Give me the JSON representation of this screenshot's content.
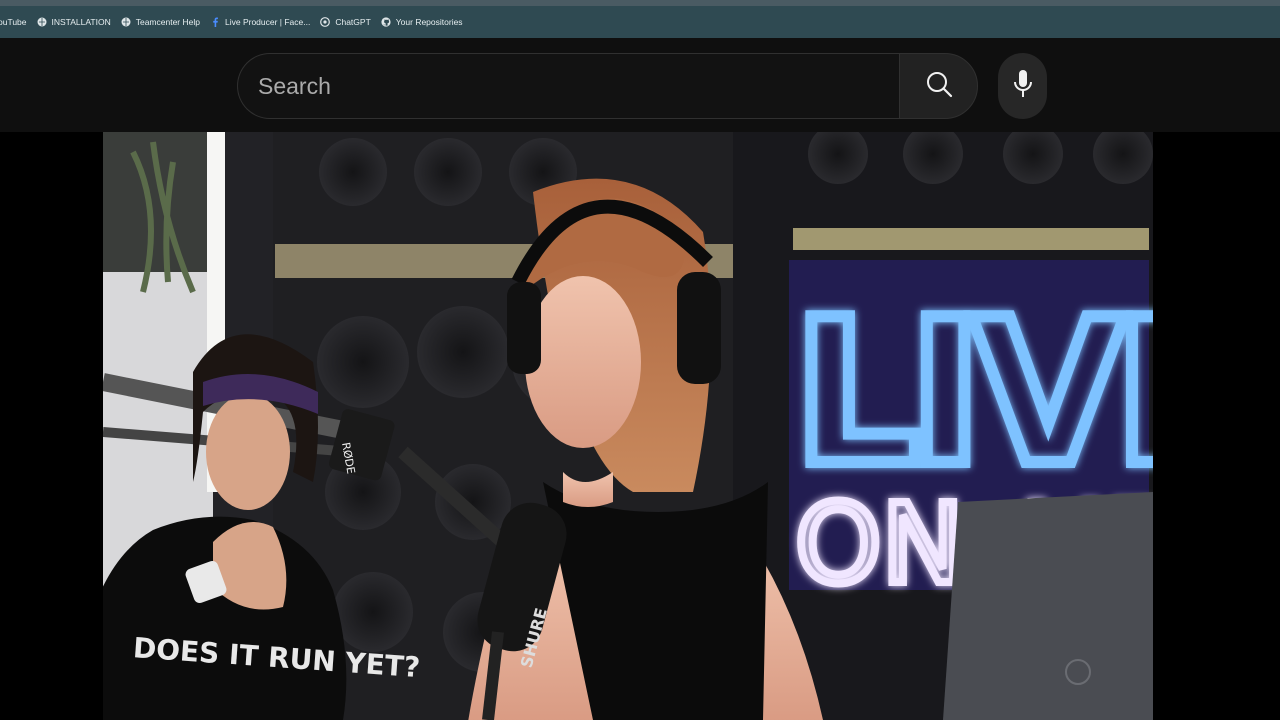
{
  "bookmarks": [
    {
      "label": "ouTube",
      "icon": "youtube-icon"
    },
    {
      "label": "INSTALLATION",
      "icon": "globe-icon"
    },
    {
      "label": "Teamcenter Help",
      "icon": "globe-icon"
    },
    {
      "label": "Live Producer | Face...",
      "icon": "facebook-icon"
    },
    {
      "label": "ChatGPT",
      "icon": "chatgpt-icon"
    },
    {
      "label": "Your Repositories",
      "icon": "github-icon"
    }
  ],
  "search": {
    "placeholder": "Search",
    "value": ""
  },
  "video": {
    "neon_sign_line1": "LIVE",
    "neon_sign_line2": "ON AIR",
    "shirt_text": "DOES IT RUN YET?",
    "mic_brand": "SHURE",
    "boom_brand": "RØDE"
  },
  "colors": {
    "bookmark_bar": "#2f4a52",
    "masthead": "#0f0f0f",
    "neon_blue": "#6fb4ff"
  }
}
